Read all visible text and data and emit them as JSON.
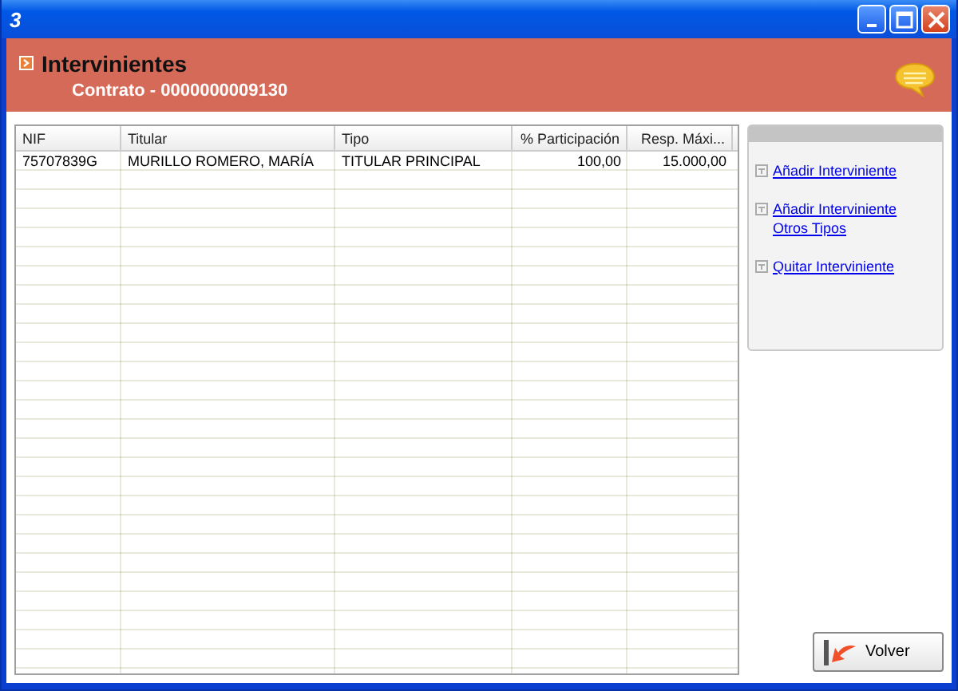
{
  "window": {
    "title_icon": "3"
  },
  "header": {
    "title": "Intervinientes",
    "subtitle": "Contrato - 0000000009130"
  },
  "table": {
    "columns": [
      "NIF",
      "Titular",
      "Tipo",
      "% Participación",
      "Resp. Máxi..."
    ],
    "rows": [
      [
        "75707839G",
        "MURILLO ROMERO, MARÍA",
        "TITULAR PRINCIPAL",
        "100,00",
        "15.000,00"
      ]
    ]
  },
  "actions": [
    "Añadir Interviniente",
    "Añadir Interviniente Otros Tipos",
    "Quitar Interviniente"
  ],
  "buttons": [
    "Volver"
  ]
}
